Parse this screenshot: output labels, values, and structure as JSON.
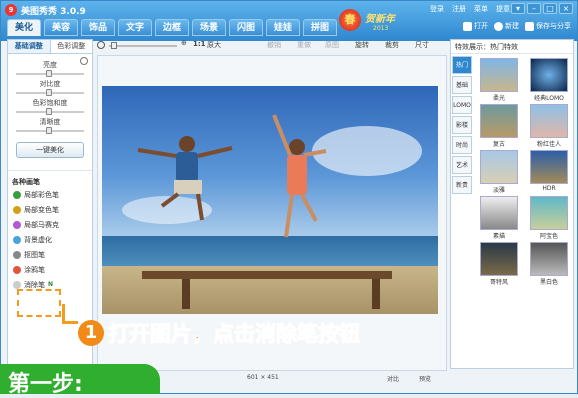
{
  "app": {
    "title": "美图秀秀 3.0.9",
    "logo": "9"
  },
  "top_menu": [
    "登录",
    "注册",
    "菜单",
    "提意见"
  ],
  "main_tabs": [
    "美化",
    "美容",
    "饰品",
    "文字",
    "边框",
    "场景",
    "闪图",
    "娃娃",
    "拼图"
  ],
  "banner": {
    "title": "贺新年",
    "year": "2013",
    "char": "春"
  },
  "actions": {
    "open": "打开",
    "new": "新建",
    "save": "保存与分享"
  },
  "left_panel": {
    "tabs": [
      "基础调整",
      "色彩调整"
    ],
    "sliders": [
      "亮度",
      "对比度",
      "色彩饱和度",
      "清晰度"
    ],
    "one_key": "一键美化",
    "brush_title": "各种画笔",
    "brushes": [
      "局部彩色笔",
      "局部变色笔",
      "局部马赛克",
      "背景虚化",
      "抠图笔",
      "涂鸦笔",
      "消除笔"
    ],
    "brush_badge": "N"
  },
  "toolbar": {
    "ratio": "1:1",
    "original": "原大",
    "undo": "撤销",
    "redo": "重做",
    "restore": "原图",
    "rotate": "旋转",
    "crop": "裁剪",
    "size": "尺寸"
  },
  "status": {
    "dimensions": "601 × 451",
    "compare": "对比",
    "preview": "预览"
  },
  "right_panel": {
    "header": "特效展示：热门特效",
    "tabs": [
      "热门",
      "基础",
      "LOMO",
      "影楼",
      "时尚",
      "艺术",
      "新贵"
    ],
    "filters": [
      "柔光",
      "经典LOMO",
      "复古",
      "粉红佳人",
      "淡雅",
      "HDR",
      "素描",
      "阿宝色",
      "哥特风",
      "黑白色"
    ]
  },
  "overlay": {
    "step": "第一步:",
    "number": "1",
    "instruction": "打开图片，点击消除笔按钮"
  }
}
